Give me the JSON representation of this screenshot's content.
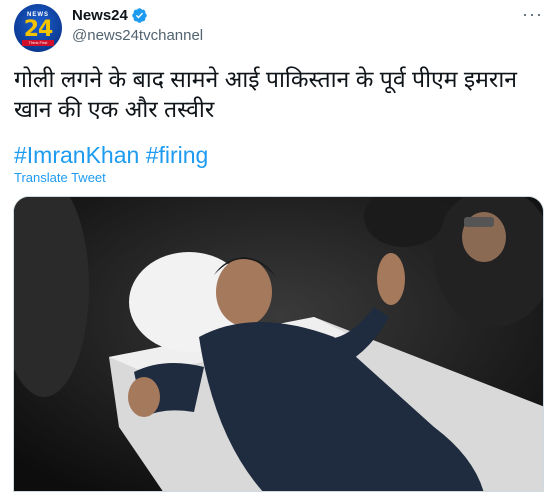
{
  "author": {
    "display_name": "News24",
    "handle": "@news24tvchannel",
    "avatar": {
      "top_text": "NEWS",
      "number": "24",
      "tagline": "Think First"
    }
  },
  "tweet": {
    "text_line1": "गोली लगने के बाद सामने आई पाकिस्तान के पूर्व पीएम इमरान",
    "text_line2": "खान की एक और तस्वीर",
    "hashtags": [
      "#ImranKhan",
      "#firing"
    ],
    "translate_label": "Translate Tweet"
  },
  "icons": {
    "verified": "verified-badge-icon",
    "more": "more-options-icon"
  },
  "colors": {
    "link": "#1d9bf0",
    "secondary": "#536471",
    "text": "#0f1419"
  }
}
